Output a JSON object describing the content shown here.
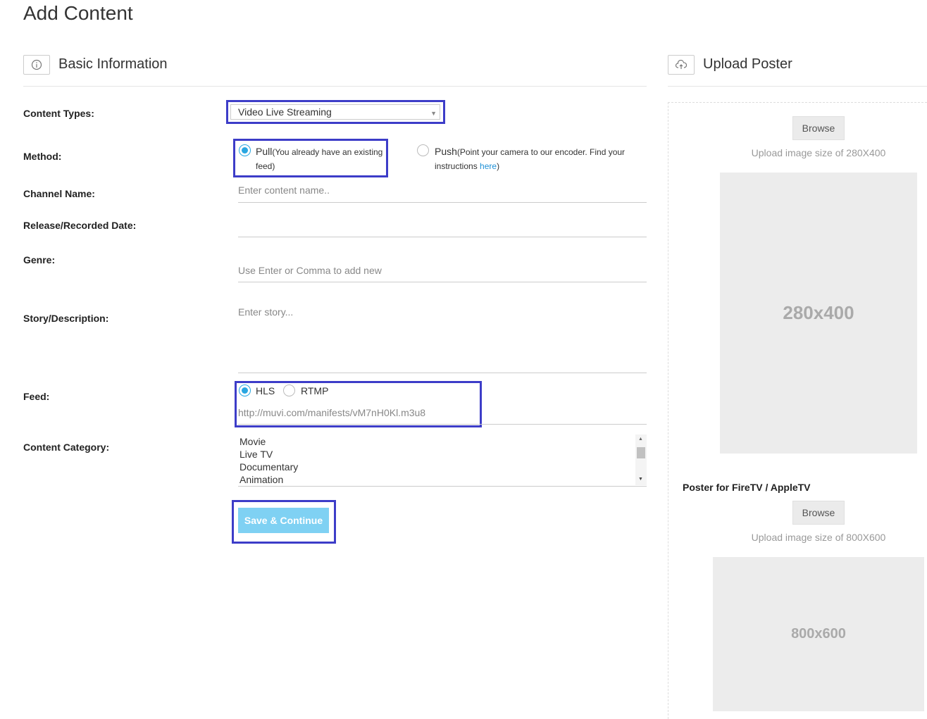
{
  "page_title": "Add Content",
  "basic_section": {
    "title": "Basic Information",
    "icon": "info-icon"
  },
  "upload_section": {
    "title": "Upload Poster",
    "icon": "cloud-upload-icon"
  },
  "form": {
    "content_types": {
      "label": "Content Types:",
      "value": "Video Live Streaming"
    },
    "method": {
      "label": "Method:",
      "pull": {
        "title": "Pull",
        "note_open": "(You already have an existing",
        "note_close": "feed)",
        "selected": true
      },
      "push": {
        "title": "Push",
        "note_open": "(Point your camera to our encoder. Find your",
        "note_line2": "instructions ",
        "link": "here",
        "note_close": ")",
        "selected": false
      }
    },
    "channel_name": {
      "label": "Channel Name:",
      "placeholder": "Enter content name.."
    },
    "release_date": {
      "label": "Release/Recorded Date:"
    },
    "genre": {
      "label": "Genre:",
      "placeholder": "Use Enter or Comma to add new"
    },
    "story": {
      "label": "Story/Description:",
      "placeholder": "Enter story..."
    },
    "feed": {
      "label": "Feed:",
      "options": [
        {
          "label": "HLS",
          "selected": true
        },
        {
          "label": "RTMP",
          "selected": false
        }
      ],
      "url": "http://muvi.com/manifests/vM7nH0Kl.m3u8"
    },
    "content_category": {
      "label": "Content Category:",
      "items": [
        "Movie",
        "Live TV",
        "Documentary",
        "Animation"
      ]
    },
    "save_label": "Save & Continue"
  },
  "poster": {
    "browse_label": "Browse",
    "hint": "Upload image size of 280X400",
    "preview_label": "280x400"
  },
  "tv_poster": {
    "title": "Poster for FireTV / AppleTV",
    "browse_label": "Browse",
    "hint": "Upload image size of 800X600",
    "preview_label": "800x600"
  },
  "colors": {
    "accent": "#29a7e1",
    "highlight": "#3d3dc8",
    "save_button": "#7fd1f3",
    "placeholder_bg": "#ececec"
  }
}
